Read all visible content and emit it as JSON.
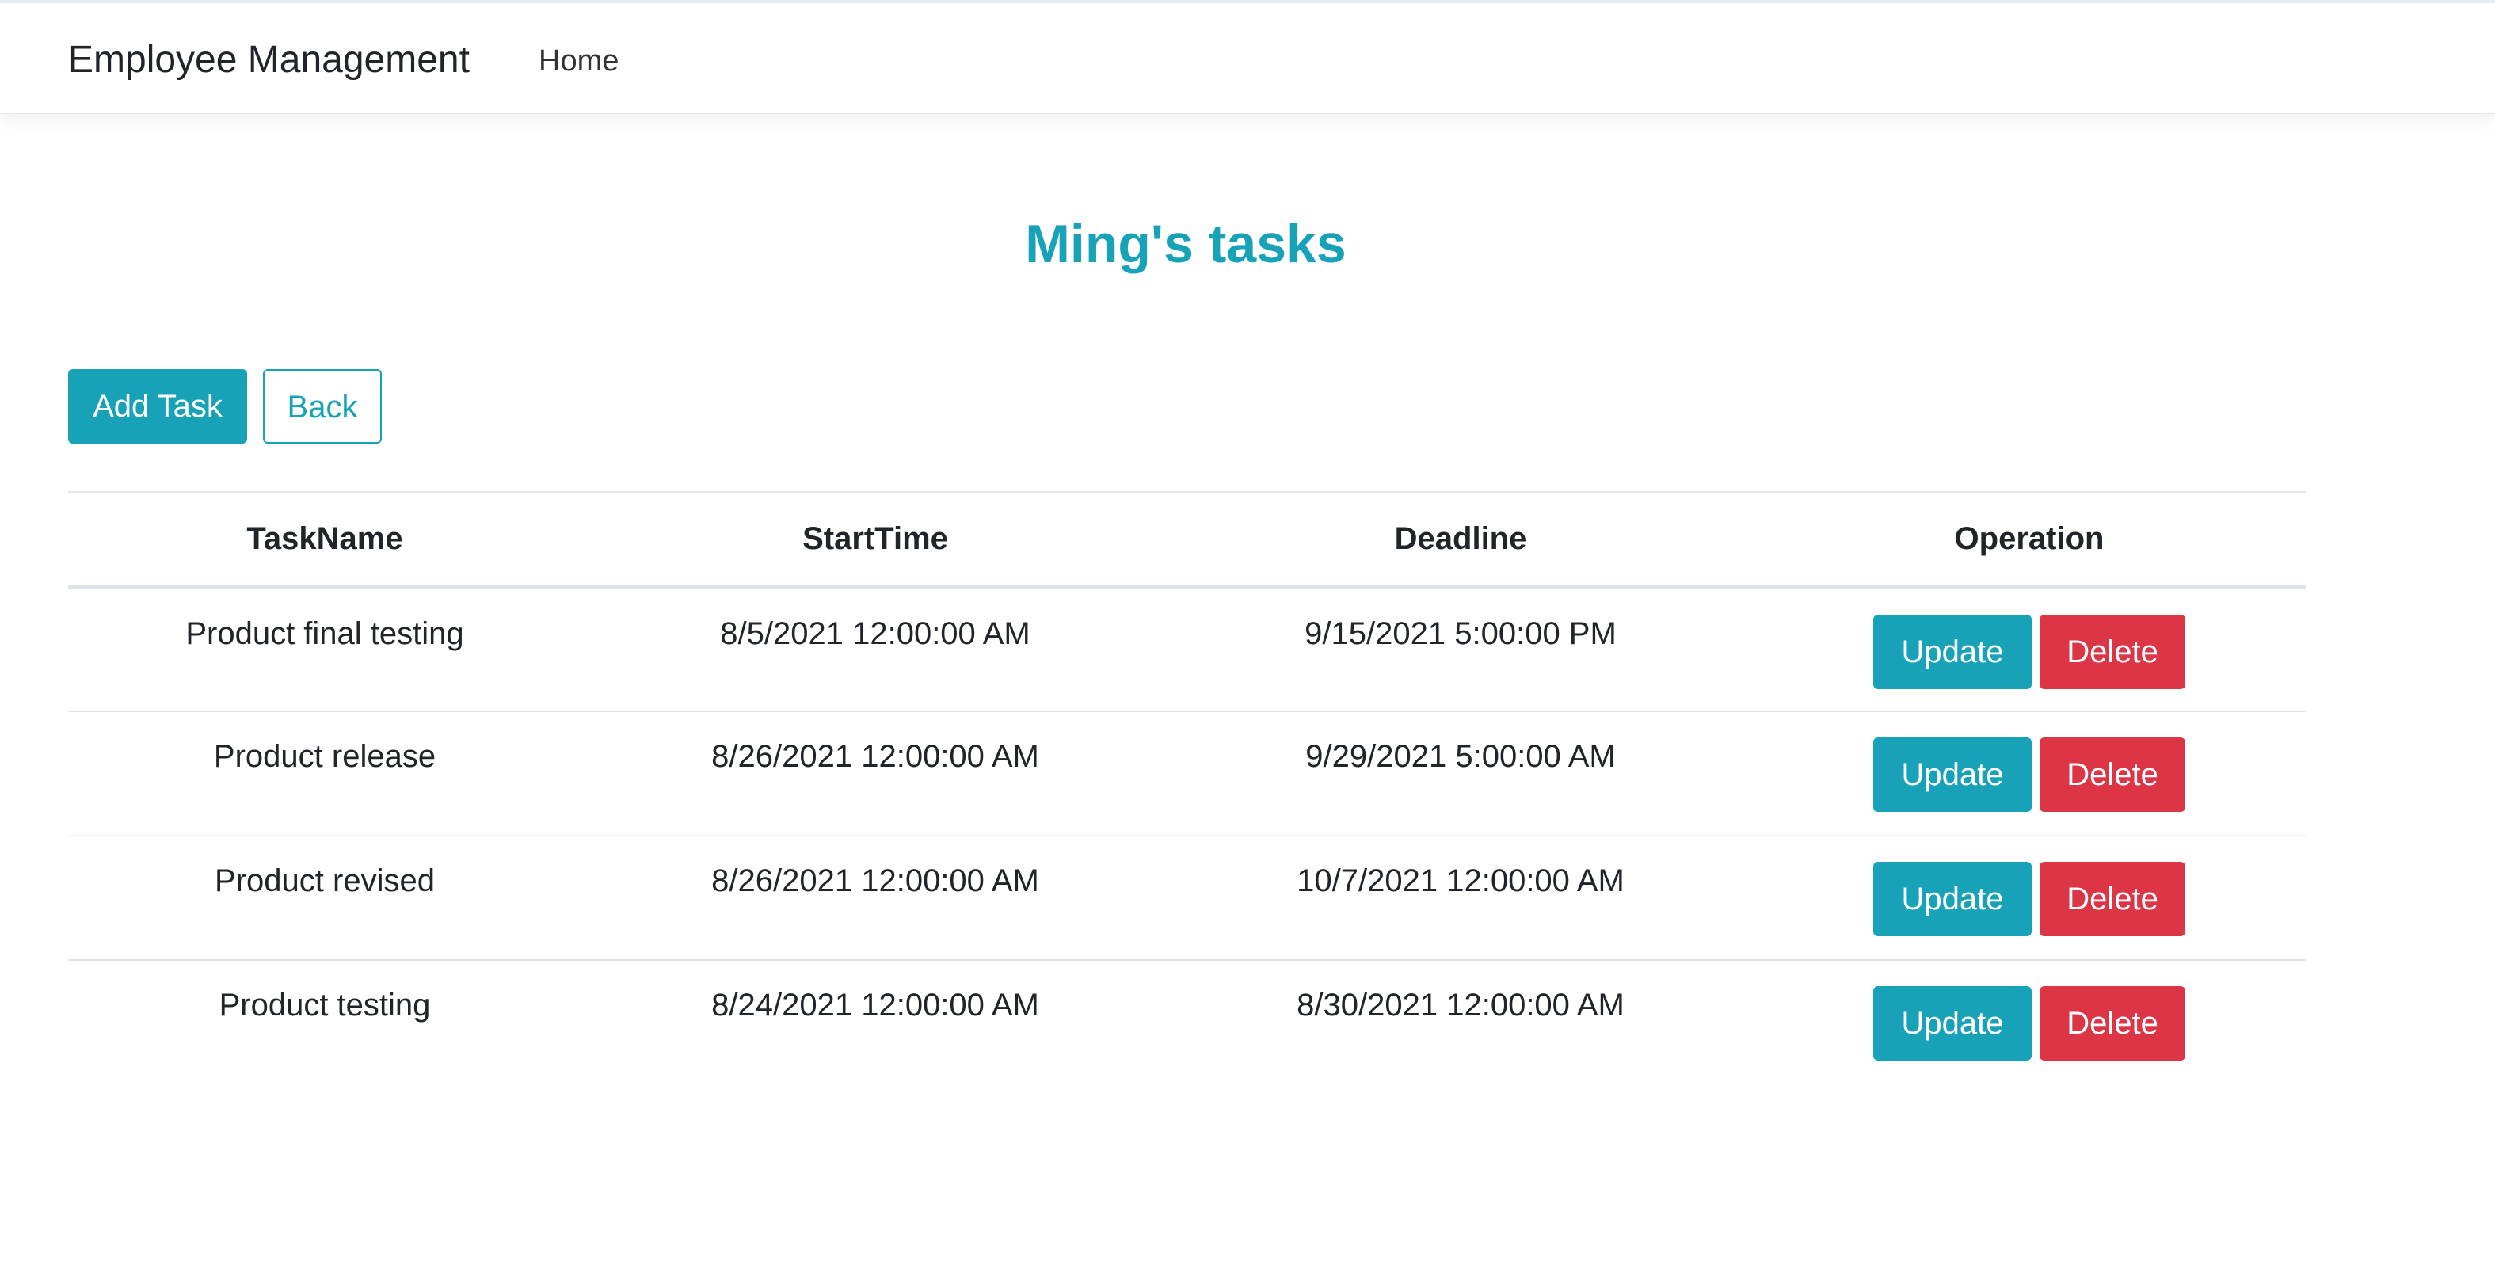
{
  "navbar": {
    "brand": "Employee Management",
    "home_label": "Home"
  },
  "page": {
    "title": "Ming's tasks"
  },
  "actions": {
    "add_label": "Add Task",
    "back_label": "Back"
  },
  "table": {
    "headers": [
      "TaskName",
      "StartTime",
      "Deadline",
      "Operation"
    ],
    "rows": [
      {
        "name": "Product final testing",
        "start": "8/5/2021 12:00:00 AM",
        "deadline": "9/15/2021 5:00:00 PM",
        "update": "Update",
        "delete": "Delete"
      },
      {
        "name": "Product release",
        "start": "8/26/2021 12:00:00 AM",
        "deadline": "9/29/2021 5:00:00 AM",
        "update": "Update",
        "delete": "Delete"
      },
      {
        "name": "Product revised",
        "start": "8/26/2021 12:00:00 AM",
        "deadline": "10/7/2021 12:00:00 AM",
        "update": "Update",
        "delete": "Delete"
      },
      {
        "name": "Product testing",
        "start": "8/24/2021 12:00:00 AM",
        "deadline": "8/30/2021 12:00:00 AM",
        "update": "Update",
        "delete": "Delete"
      }
    ]
  },
  "colors": {
    "primary": "#17a2b8",
    "danger": "#dc3545",
    "text": "#212529"
  }
}
